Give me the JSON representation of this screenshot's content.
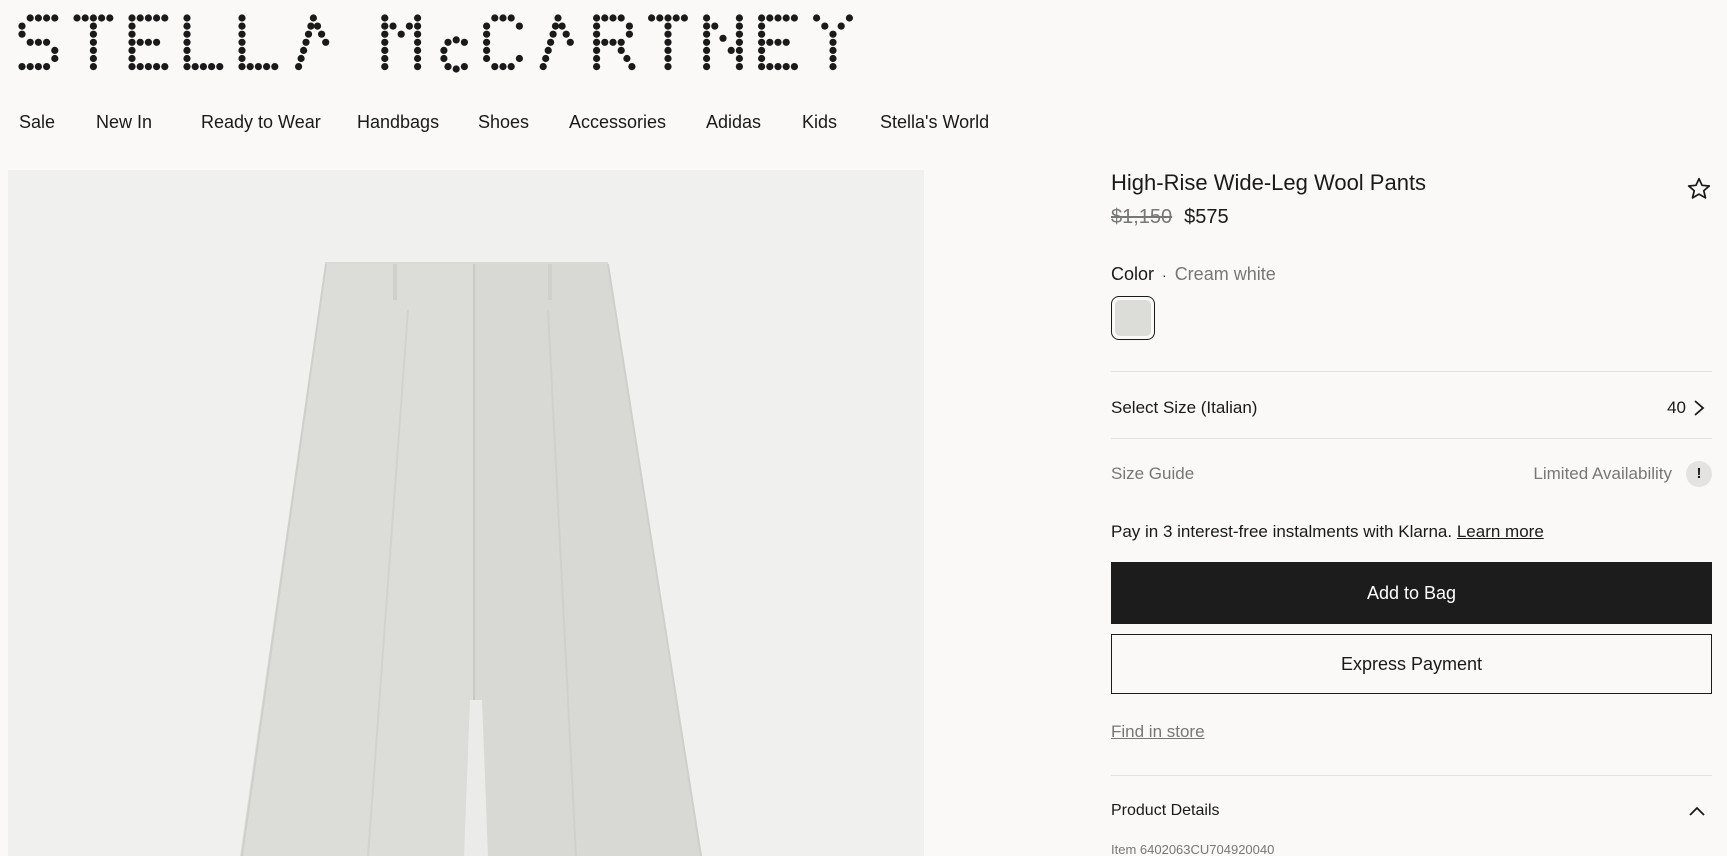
{
  "brand": {
    "logo_text": "STELLA McCARTNEY"
  },
  "nav": {
    "items": [
      {
        "label": "Sale"
      },
      {
        "label": "New In"
      },
      {
        "label": "Ready to Wear"
      },
      {
        "label": "Handbags"
      },
      {
        "label": "Shoes"
      },
      {
        "label": "Accessories"
      },
      {
        "label": "Adidas"
      },
      {
        "label": "Kids"
      },
      {
        "label": "Stella's World"
      }
    ]
  },
  "product": {
    "title": "High-Rise Wide-Leg Wool Pants",
    "price_original": "$1,150",
    "price_sale": "$575",
    "color_label": "Color",
    "color_separator": "·",
    "color_value": "Cream white",
    "swatch_color": "#dcdcd8",
    "size_label": "Select Size (Italian)",
    "size_value": "40",
    "size_guide_label": "Size Guide",
    "availability_label": "Limited Availability",
    "availability_icon": "!",
    "klarna_text": "Pay in 3 interest-free instalments with Klarna.",
    "klarna_link": "Learn more",
    "add_to_bag_label": "Add to Bag",
    "express_payment_label": "Express Payment",
    "find_in_store_label": "Find in store",
    "details_title": "Product Details",
    "item_code": "Item 6402063CU704920040"
  },
  "colors": {
    "background": "#faf9f7",
    "primary_button": "#1c1c1c",
    "muted_text": "#777777",
    "image_bg": "#f0f0ef",
    "garment": "#dcdcd8"
  }
}
